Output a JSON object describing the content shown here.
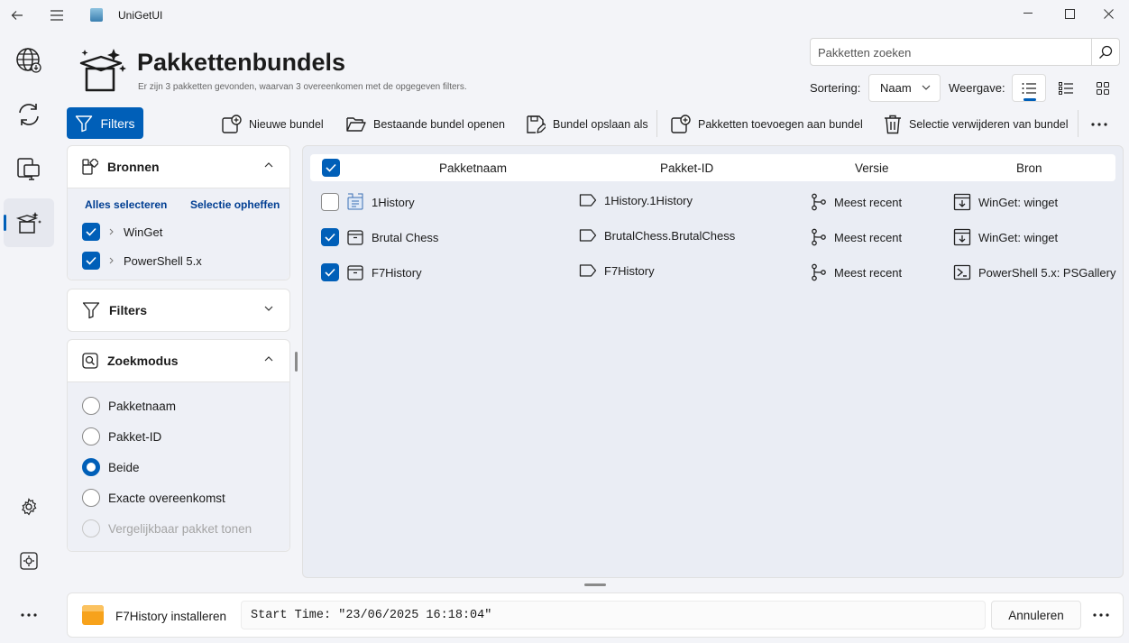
{
  "app": {
    "title": "UniGetUI"
  },
  "page": {
    "title": "Pakkettenbundels",
    "subtitle": "Er zijn 3 pakketten gevonden, waarvan 3 overeenkomen met de opgegeven filters."
  },
  "search": {
    "placeholder": "Pakketten zoeken"
  },
  "sort": {
    "label": "Sortering:",
    "value": "Naam"
  },
  "view": {
    "label": "Weergave:"
  },
  "filters_button": "Filters",
  "toolbar": {
    "new_bundle": "Nieuwe bundel",
    "open_bundle": "Bestaande bundel openen",
    "save_bundle": "Bundel opslaan als",
    "add_packages": "Pakketten toevoegen aan bundel",
    "remove_selection": "Selectie verwijderen van bundel"
  },
  "sources_panel": {
    "title": "Bronnen",
    "select_all": "Alles selecteren",
    "deselect": "Selectie opheffen",
    "items": [
      {
        "label": "WinGet",
        "checked": true
      },
      {
        "label": "PowerShell 5.x",
        "checked": true
      }
    ]
  },
  "filters_panel": {
    "title": "Filters"
  },
  "search_mode_panel": {
    "title": "Zoekmodus",
    "options": [
      {
        "label": "Pakketnaam",
        "selected": false,
        "disabled": false
      },
      {
        "label": "Pakket-ID",
        "selected": false,
        "disabled": false
      },
      {
        "label": "Beide",
        "selected": true,
        "disabled": false
      },
      {
        "label": "Exacte overeenkomst",
        "selected": false,
        "disabled": false
      },
      {
        "label": "Vergelijkbaar pakket tonen",
        "selected": false,
        "disabled": true
      }
    ]
  },
  "table": {
    "columns": [
      "Pakketnaam",
      "Pakket-ID",
      "Versie",
      "Bron"
    ],
    "rows": [
      {
        "checked": false,
        "name": "1History",
        "id": "1History.1History",
        "version": "Meest recent",
        "source": "WinGet: winget"
      },
      {
        "checked": true,
        "name": "Brutal Chess",
        "id": "BrutalChess.BrutalChess",
        "version": "Meest recent",
        "source": "WinGet: winget"
      },
      {
        "checked": true,
        "name": "F7History",
        "id": "F7History",
        "version": "Meest recent",
        "source": "PowerShell 5.x: PSGallery"
      }
    ]
  },
  "operation": {
    "title": "F7History installeren",
    "log": "Start Time: \"23/06/2025 16:18:04\"",
    "cancel": "Annuleren"
  },
  "colors": {
    "accent": "#005fb8",
    "background": "#f3f4f8"
  }
}
